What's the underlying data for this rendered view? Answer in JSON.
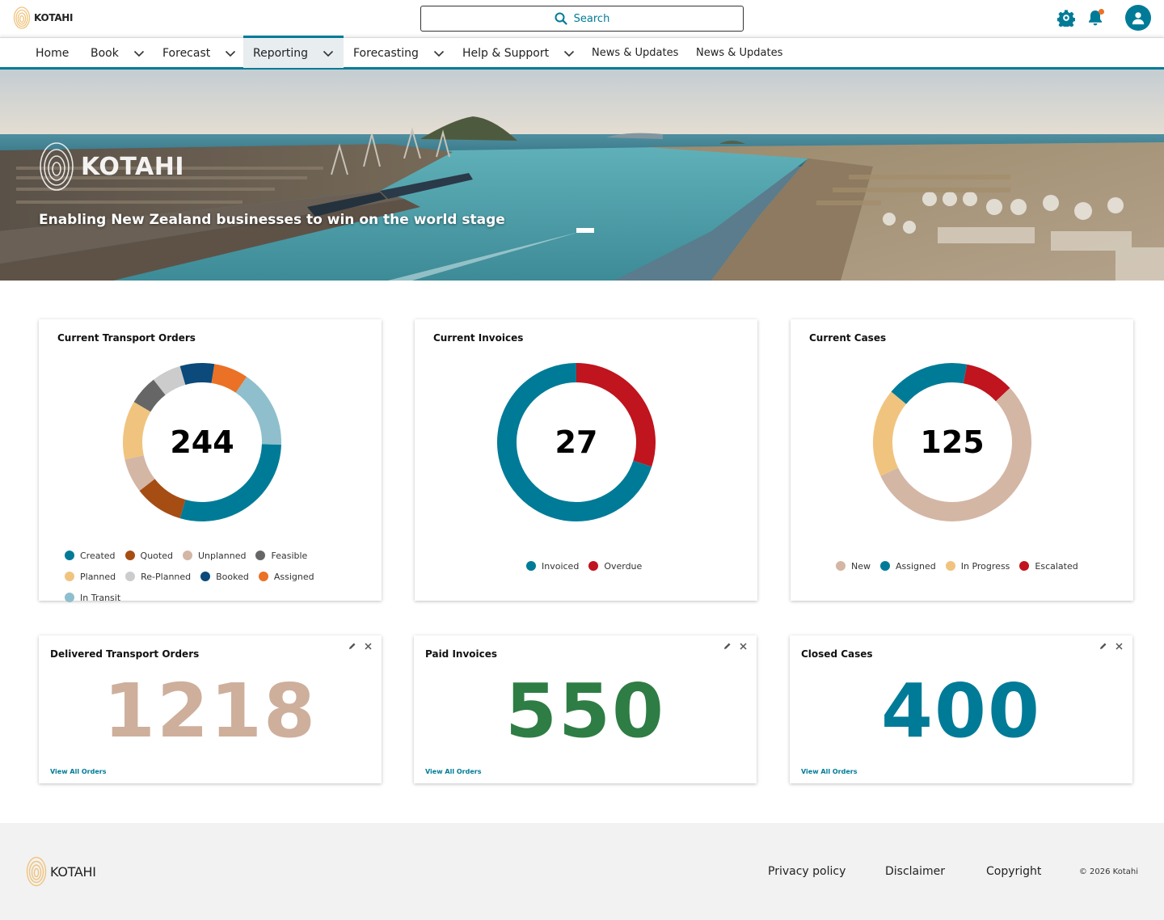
{
  "header": {
    "brand": "KOTAHI",
    "search_placeholder": "Search",
    "icons": [
      "gear-icon",
      "bell-icon",
      "user-icon"
    ],
    "accent": "#007b97",
    "notification_color": "#ea7125"
  },
  "nav": {
    "items": [
      {
        "label": "Home"
      },
      {
        "label": "Book"
      },
      {
        "label": "Forecast"
      },
      {
        "label": "Reporting"
      },
      {
        "label": "Forecasting"
      },
      {
        "label": "Help & Support"
      },
      {
        "label": "News & Updates"
      },
      {
        "label": "News & Updates"
      }
    ],
    "active": "Reporting"
  },
  "hero": {
    "brand": "KOTAHI",
    "tagline": "Enabling New Zealand businesses to win on the world stage"
  },
  "cards": {
    "transport": {
      "title": "Current Transport Orders",
      "total": "244",
      "legend": [
        {
          "label": "Created",
          "color": "#007b97"
        },
        {
          "label": "Quoted",
          "color": "#a64d14"
        },
        {
          "label": "Unplanned",
          "color": "#d4b6a5"
        },
        {
          "label": "Feasible",
          "color": "#666666"
        },
        {
          "label": "Planned",
          "color": "#f0c47e"
        },
        {
          "label": "Re-Planned",
          "color": "#cccccc"
        },
        {
          "label": "Booked",
          "color": "#0b4a7a"
        },
        {
          "label": "Assigned",
          "color": "#ea7125"
        },
        {
          "label": "In Transit",
          "color": "#8fbfcc"
        }
      ]
    },
    "invoices": {
      "title": "Current Invoices",
      "total": "27",
      "legend": [
        {
          "label": "Invoiced",
          "color": "#007b97"
        },
        {
          "label": "Overdue",
          "color": "#c0141e"
        }
      ]
    },
    "cases": {
      "title": "Current Cases",
      "total": "125",
      "legend": [
        {
          "label": "New",
          "color": "#d4b6a5"
        },
        {
          "label": "Assigned",
          "color": "#007b97"
        },
        {
          "label": "In Progress",
          "color": "#f0c47e"
        },
        {
          "label": "Escalated",
          "color": "#c0141e"
        }
      ]
    }
  },
  "kpis": {
    "delivered": {
      "title": "Delivered Transport Orders",
      "value": "1218",
      "link": "View All Orders",
      "color": "#ceaf9c"
    },
    "paid": {
      "title": "Paid Invoices",
      "value": "550",
      "link": "View All Orders",
      "color": "#2e7d44"
    },
    "closed": {
      "title": "Closed Cases",
      "value": "400",
      "link": "View All Orders",
      "color": "#007b97"
    }
  },
  "chart_data": [
    {
      "type": "pie",
      "title": "Current Transport Orders",
      "categories": [
        "Created",
        "Quoted",
        "Unplanned",
        "Feasible",
        "Planned",
        "Re-Planned",
        "Booked",
        "Assigned",
        "In Transit"
      ],
      "values": [
        0.29,
        0.1,
        0.07,
        0.06,
        0.12,
        0.06,
        0.07,
        0.07,
        0.16
      ],
      "total": 244,
      "donut": true,
      "start": "In Transit"
    },
    {
      "type": "pie",
      "title": "Current Invoices",
      "categories": [
        "Invoiced",
        "Overdue"
      ],
      "values": [
        0.7,
        0.3
      ],
      "total": 27,
      "donut": true
    },
    {
      "type": "pie",
      "title": "Current Cases",
      "categories": [
        "New",
        "Assigned",
        "In Progress",
        "Escalated"
      ],
      "values": [
        0.55,
        0.17,
        0.18,
        0.1
      ],
      "total": 125,
      "donut": true
    }
  ],
  "footer": {
    "brand": "KOTAHI",
    "links": [
      "Privacy policy",
      "Disclaimer",
      "Copyright"
    ],
    "copyright": "© 2026 Kotahi"
  }
}
